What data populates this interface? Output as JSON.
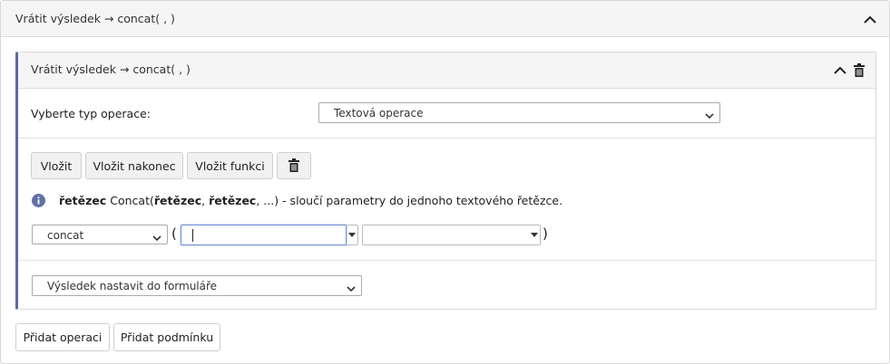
{
  "outer": {
    "title": "Vrátit výsledek → concat( ,  )"
  },
  "inner": {
    "title": "Vrátit výsledek → concat( ,  )",
    "operation_label": "Vyberte typ operace:",
    "operation_selected": "Textová operace"
  },
  "toolbar": {
    "insert_label": "Vložit",
    "insert_end_label": "Vložit nakonec",
    "insert_function_label": "Vložit funkci"
  },
  "info": {
    "return_type": "řetězec",
    "fn_name": "Concat(",
    "param1": "řetězec",
    "sep1": ", ",
    "param2": "řetězec",
    "rest": ", ...)",
    "description": " - sloučí parametry do jednoho textového řetězce."
  },
  "expression": {
    "function_selected": "concat",
    "open_paren": "(",
    "close_paren": ")",
    "arg1_value": "",
    "arg2_value": ""
  },
  "result": {
    "target_selected": "Výsledek nastavit do formuláře"
  },
  "footer": {
    "add_operation_label": "Přidat operaci",
    "add_condition_label": "Přidat podmínku"
  },
  "icons": {
    "collapse": "chevron-up-icon",
    "delete": "trash-icon",
    "info": "info-icon",
    "dropdown": "chevron-down-icon"
  },
  "colors": {
    "accent_border": "#5a6aa6",
    "info_icon": "#6470a8",
    "focus_border": "#6d8fd6"
  }
}
